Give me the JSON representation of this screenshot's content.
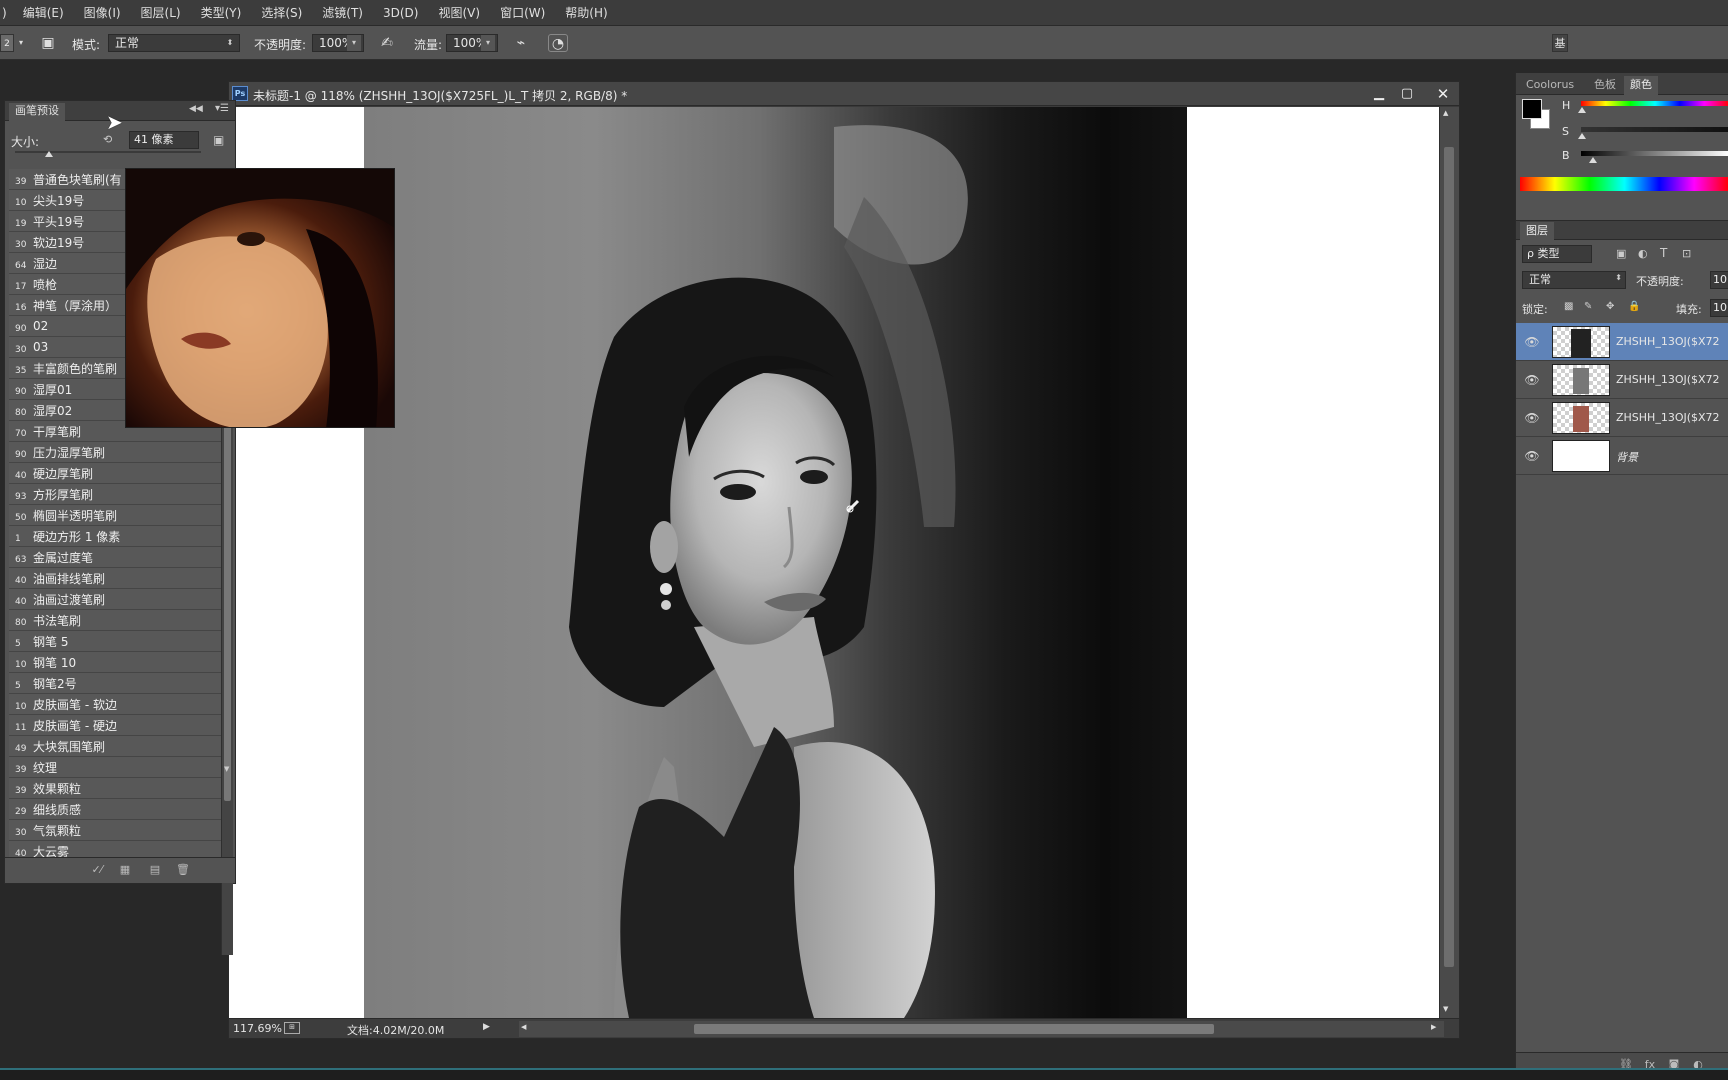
{
  "menubar": {
    "lead": ")",
    "items": [
      "编辑(E)",
      "图像(I)",
      "图层(L)",
      "类型(Y)",
      "选择(S)",
      "滤镜(T)",
      "3D(D)",
      "视图(V)",
      "窗口(W)",
      "帮助(H)"
    ]
  },
  "options": {
    "brush_size_hint": "2",
    "mode_label": "模式:",
    "mode_value": "正常",
    "opacity_label": "不透明度:",
    "opacity_value": "100%",
    "flow_label": "流量:",
    "flow_value": "100%",
    "right_edge_btn": "基"
  },
  "brush_panel": {
    "tab": "画笔预设",
    "size_label": "大小:",
    "size_value": "41 像素",
    "brushes": [
      {
        "num": "39",
        "name": "普通色块笔刷(有"
      },
      {
        "num": "10",
        "name": "尖头19号"
      },
      {
        "num": "19",
        "name": "平头19号"
      },
      {
        "num": "30",
        "name": "软边19号"
      },
      {
        "num": "64",
        "name": "湿边"
      },
      {
        "num": "17",
        "name": "喷枪"
      },
      {
        "num": "16",
        "name": "神笔（厚涂用）"
      },
      {
        "num": "90",
        "name": "02"
      },
      {
        "num": "30",
        "name": "03"
      },
      {
        "num": "35",
        "name": "丰富颜色的笔刷"
      },
      {
        "num": "90",
        "name": "湿厚01"
      },
      {
        "num": "80",
        "name": "湿厚02"
      },
      {
        "num": "70",
        "name": "干厚笔刷"
      },
      {
        "num": "90",
        "name": "压力湿厚笔刷"
      },
      {
        "num": "40",
        "name": "硬边厚笔刷"
      },
      {
        "num": "93",
        "name": "方形厚笔刷"
      },
      {
        "num": "50",
        "name": "椭圆半透明笔刷"
      },
      {
        "num": "1",
        "name": "硬边方形 1 像素"
      },
      {
        "num": "63",
        "name": "金属过度笔"
      },
      {
        "num": "40",
        "name": "油画排线笔刷"
      },
      {
        "num": "40",
        "name": "油画过渡笔刷"
      },
      {
        "num": "80",
        "name": "书法笔刷"
      },
      {
        "num": "5",
        "name": "钢笔 5"
      },
      {
        "num": "10",
        "name": "钢笔 10"
      },
      {
        "num": "5",
        "name": "钢笔2号"
      },
      {
        "num": "10",
        "name": "皮肤画笔 - 软边"
      },
      {
        "num": "11",
        "name": "皮肤画笔 - 硬边"
      },
      {
        "num": "49",
        "name": "大块氛围笔刷"
      },
      {
        "num": "39",
        "name": "纹理"
      },
      {
        "num": "39",
        "name": "效果颗粒"
      },
      {
        "num": "29",
        "name": "细线质感"
      },
      {
        "num": "30",
        "name": "气氛颗粒"
      },
      {
        "num": "40",
        "name": "大云雾"
      }
    ]
  },
  "document": {
    "title": "未标题-1 @ 118% (ZHSHH_13OJ($X725FL_)L_T 拷贝 2, RGB/8) *",
    "zoom": "117.69%",
    "doc_info": "文档:4.02M/20.0M"
  },
  "color_panel": {
    "tabs": [
      "Coolorus",
      "色板",
      "颜色"
    ],
    "active_tab": "颜色",
    "labels": {
      "h": "H",
      "s": "S",
      "b": "B"
    },
    "foreground": "#000000",
    "background": "#ffffff"
  },
  "layers_panel": {
    "tab": "图层",
    "filter": "ρ 类型",
    "blend": "正常",
    "opacity_label": "不透明度:",
    "opacity_value": "10",
    "lock_label": "锁定:",
    "fill_label": "填充:",
    "fill_value": "10",
    "layers": [
      {
        "name": "ZHSHH_13OJ($X72",
        "selected": true
      },
      {
        "name": "ZHSHH_13OJ($X72",
        "selected": false
      },
      {
        "name": "ZHSHH_13OJ($X72",
        "selected": false
      },
      {
        "name": "背景",
        "selected": false
      }
    ]
  }
}
